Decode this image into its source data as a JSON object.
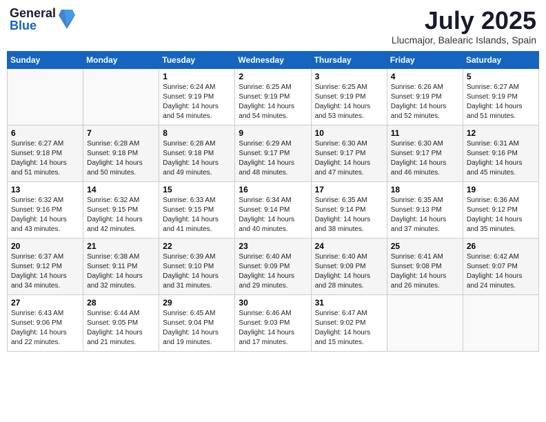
{
  "header": {
    "logo_general": "General",
    "logo_blue": "Blue",
    "month_title": "July 2025",
    "location": "Llucmajor, Balearic Islands, Spain"
  },
  "weekdays": [
    "Sunday",
    "Monday",
    "Tuesday",
    "Wednesday",
    "Thursday",
    "Friday",
    "Saturday"
  ],
  "weeks": [
    [
      {
        "day": "",
        "info": ""
      },
      {
        "day": "",
        "info": ""
      },
      {
        "day": "1",
        "info": "Sunrise: 6:24 AM\nSunset: 9:19 PM\nDaylight: 14 hours\nand 54 minutes."
      },
      {
        "day": "2",
        "info": "Sunrise: 6:25 AM\nSunset: 9:19 PM\nDaylight: 14 hours\nand 54 minutes."
      },
      {
        "day": "3",
        "info": "Sunrise: 6:25 AM\nSunset: 9:19 PM\nDaylight: 14 hours\nand 53 minutes."
      },
      {
        "day": "4",
        "info": "Sunrise: 6:26 AM\nSunset: 9:19 PM\nDaylight: 14 hours\nand 52 minutes."
      },
      {
        "day": "5",
        "info": "Sunrise: 6:27 AM\nSunset: 9:19 PM\nDaylight: 14 hours\nand 51 minutes."
      }
    ],
    [
      {
        "day": "6",
        "info": "Sunrise: 6:27 AM\nSunset: 9:18 PM\nDaylight: 14 hours\nand 51 minutes."
      },
      {
        "day": "7",
        "info": "Sunrise: 6:28 AM\nSunset: 9:18 PM\nDaylight: 14 hours\nand 50 minutes."
      },
      {
        "day": "8",
        "info": "Sunrise: 6:28 AM\nSunset: 9:18 PM\nDaylight: 14 hours\nand 49 minutes."
      },
      {
        "day": "9",
        "info": "Sunrise: 6:29 AM\nSunset: 9:17 PM\nDaylight: 14 hours\nand 48 minutes."
      },
      {
        "day": "10",
        "info": "Sunrise: 6:30 AM\nSunset: 9:17 PM\nDaylight: 14 hours\nand 47 minutes."
      },
      {
        "day": "11",
        "info": "Sunrise: 6:30 AM\nSunset: 9:17 PM\nDaylight: 14 hours\nand 46 minutes."
      },
      {
        "day": "12",
        "info": "Sunrise: 6:31 AM\nSunset: 9:16 PM\nDaylight: 14 hours\nand 45 minutes."
      }
    ],
    [
      {
        "day": "13",
        "info": "Sunrise: 6:32 AM\nSunset: 9:16 PM\nDaylight: 14 hours\nand 43 minutes."
      },
      {
        "day": "14",
        "info": "Sunrise: 6:32 AM\nSunset: 9:15 PM\nDaylight: 14 hours\nand 42 minutes."
      },
      {
        "day": "15",
        "info": "Sunrise: 6:33 AM\nSunset: 9:15 PM\nDaylight: 14 hours\nand 41 minutes."
      },
      {
        "day": "16",
        "info": "Sunrise: 6:34 AM\nSunset: 9:14 PM\nDaylight: 14 hours\nand 40 minutes."
      },
      {
        "day": "17",
        "info": "Sunrise: 6:35 AM\nSunset: 9:14 PM\nDaylight: 14 hours\nand 38 minutes."
      },
      {
        "day": "18",
        "info": "Sunrise: 6:35 AM\nSunset: 9:13 PM\nDaylight: 14 hours\nand 37 minutes."
      },
      {
        "day": "19",
        "info": "Sunrise: 6:36 AM\nSunset: 9:12 PM\nDaylight: 14 hours\nand 35 minutes."
      }
    ],
    [
      {
        "day": "20",
        "info": "Sunrise: 6:37 AM\nSunset: 9:12 PM\nDaylight: 14 hours\nand 34 minutes."
      },
      {
        "day": "21",
        "info": "Sunrise: 6:38 AM\nSunset: 9:11 PM\nDaylight: 14 hours\nand 32 minutes."
      },
      {
        "day": "22",
        "info": "Sunrise: 6:39 AM\nSunset: 9:10 PM\nDaylight: 14 hours\nand 31 minutes."
      },
      {
        "day": "23",
        "info": "Sunrise: 6:40 AM\nSunset: 9:09 PM\nDaylight: 14 hours\nand 29 minutes."
      },
      {
        "day": "24",
        "info": "Sunrise: 6:40 AM\nSunset: 9:09 PM\nDaylight: 14 hours\nand 28 minutes."
      },
      {
        "day": "25",
        "info": "Sunrise: 6:41 AM\nSunset: 9:08 PM\nDaylight: 14 hours\nand 26 minutes."
      },
      {
        "day": "26",
        "info": "Sunrise: 6:42 AM\nSunset: 9:07 PM\nDaylight: 14 hours\nand 24 minutes."
      }
    ],
    [
      {
        "day": "27",
        "info": "Sunrise: 6:43 AM\nSunset: 9:06 PM\nDaylight: 14 hours\nand 22 minutes."
      },
      {
        "day": "28",
        "info": "Sunrise: 6:44 AM\nSunset: 9:05 PM\nDaylight: 14 hours\nand 21 minutes."
      },
      {
        "day": "29",
        "info": "Sunrise: 6:45 AM\nSunset: 9:04 PM\nDaylight: 14 hours\nand 19 minutes."
      },
      {
        "day": "30",
        "info": "Sunrise: 6:46 AM\nSunset: 9:03 PM\nDaylight: 14 hours\nand 17 minutes."
      },
      {
        "day": "31",
        "info": "Sunrise: 6:47 AM\nSunset: 9:02 PM\nDaylight: 14 hours\nand 15 minutes."
      },
      {
        "day": "",
        "info": ""
      },
      {
        "day": "",
        "info": ""
      }
    ]
  ]
}
